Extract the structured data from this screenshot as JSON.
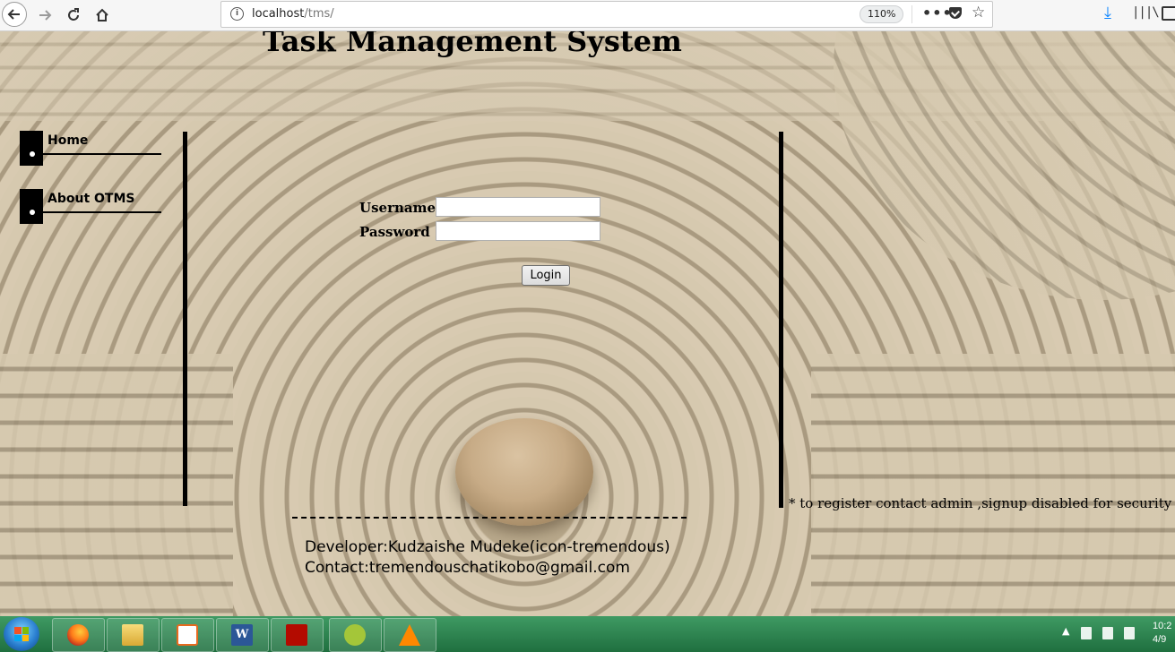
{
  "browser": {
    "url_host": "localhost",
    "url_path": "/tms/",
    "zoom": "110%",
    "icons": [
      "back-arrow-icon",
      "forward-arrow-icon",
      "reload-icon",
      "home-icon",
      "info-icon",
      "more-icon",
      "pocket-icon",
      "star-icon",
      "download-icon",
      "library-icon",
      "sidebar-icon"
    ]
  },
  "page": {
    "title": "Task Management System",
    "menu": [
      {
        "label": "Home"
      },
      {
        "label": "About OTMS"
      }
    ],
    "login": {
      "username_label": "Username:",
      "password_label": "Password :",
      "username_value": "",
      "password_value": "",
      "login_button": "Login"
    },
    "note": "* to register contact admin ,signup disabled for security reaso",
    "footer": {
      "developer": "Developer:Kudzaishe Mudeke(icon-tremendous)",
      "contact": "Contact:tremendouschatikobo@gmail.com"
    }
  },
  "taskbar": {
    "apps": [
      "firefox",
      "file-explorer",
      "media-player",
      "word",
      "acrobat",
      "android-studio",
      "vlc"
    ],
    "clock_time": "10:2",
    "clock_date": "4/9"
  },
  "colors": {
    "accent_download": "#0a84ff",
    "taskbar": "#2f8a52"
  }
}
